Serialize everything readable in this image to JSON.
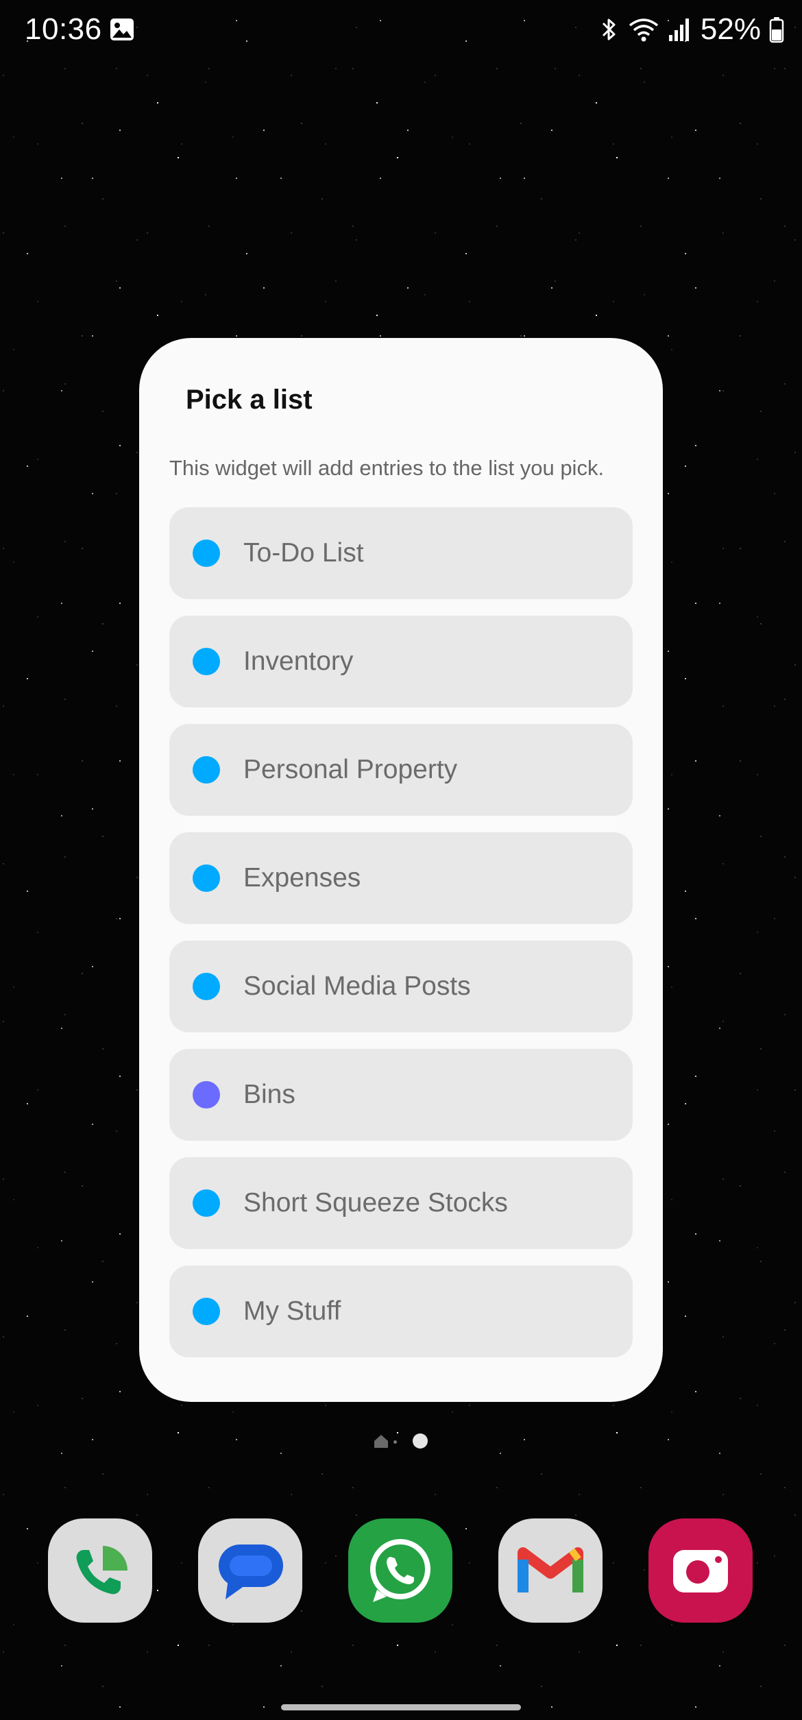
{
  "status_bar": {
    "time": "10:36",
    "battery": "52%"
  },
  "widget_dialog": {
    "title": "Pick a list",
    "description": "This widget will add entries to the list you pick.",
    "items": [
      {
        "label": "To-Do List",
        "color": "#00aaff"
      },
      {
        "label": "Inventory",
        "color": "#00aaff"
      },
      {
        "label": "Personal Property",
        "color": "#00aaff"
      },
      {
        "label": "Expenses",
        "color": "#00aaff"
      },
      {
        "label": "Social Media Posts",
        "color": "#00aaff"
      },
      {
        "label": "Bins",
        "color": "#6b6bff"
      },
      {
        "label": "Short Squeeze Stocks",
        "color": "#00aaff"
      },
      {
        "label": "My Stuff",
        "color": "#00aaff"
      }
    ]
  },
  "dock": {
    "apps": [
      {
        "icon": "phone-icon"
      },
      {
        "icon": "messages-icon"
      },
      {
        "icon": "whatsapp-icon"
      },
      {
        "icon": "gmail-icon"
      },
      {
        "icon": "camera-icon"
      }
    ]
  }
}
